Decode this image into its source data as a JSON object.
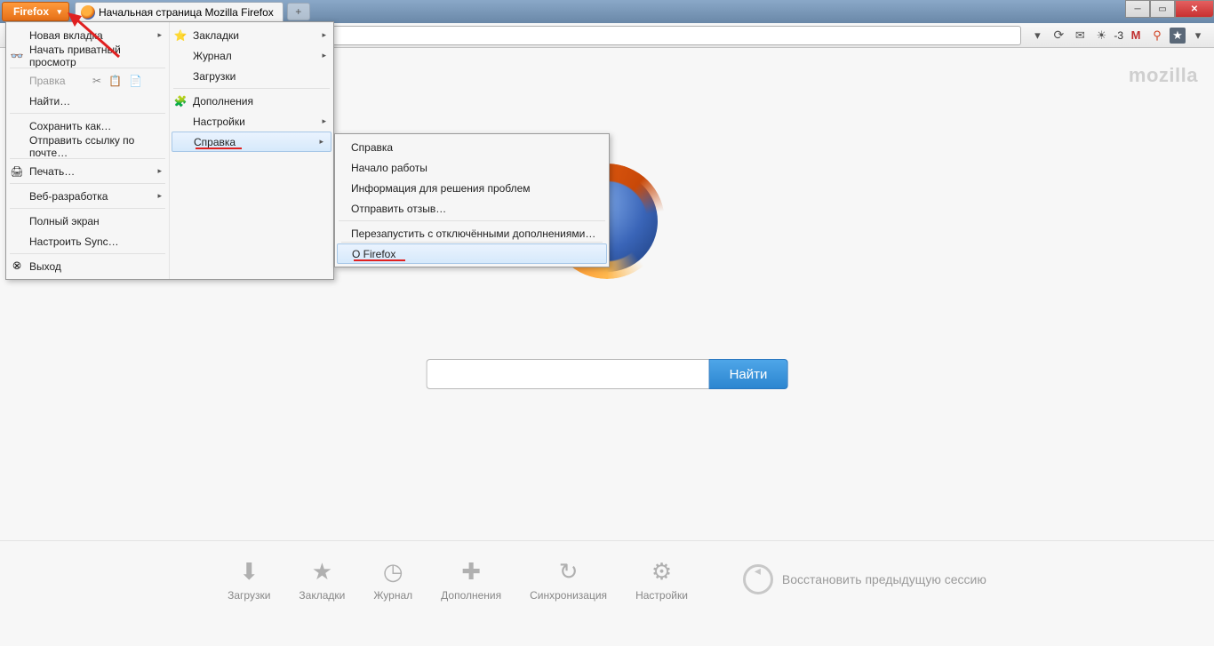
{
  "titlebar": {
    "firefox_button": "Firefox",
    "tab_title": "Начальная страница Mozilla Firefox",
    "new_tab_symbol": "+"
  },
  "toolbar": {
    "temp_text": "-3"
  },
  "main_menu": {
    "left": [
      {
        "label": "Новая вкладка",
        "arrow": true
      },
      {
        "label": "Начать приватный просмотр",
        "icon": "mask"
      },
      {
        "label": "Правка",
        "disabled": true,
        "sep": true,
        "icons_row": true
      },
      {
        "label": "Найти…"
      },
      {
        "label": "Сохранить как…",
        "sep": true
      },
      {
        "label": "Отправить ссылку по почте…"
      },
      {
        "label": "Печать…",
        "icon": "print",
        "arrow": true,
        "sep": true
      },
      {
        "label": "Веб-разработка",
        "arrow": true,
        "sep": true
      },
      {
        "label": "Полный экран",
        "sep": true
      },
      {
        "label": "Настроить Sync…"
      },
      {
        "label": "Выход",
        "icon": "exit",
        "sep": true
      }
    ],
    "right": [
      {
        "label": "Закладки",
        "arrow": true,
        "icon": "star"
      },
      {
        "label": "Журнал",
        "arrow": true
      },
      {
        "label": "Загрузки"
      },
      {
        "label": "Дополнения",
        "icon": "puzzle",
        "sep": true
      },
      {
        "label": "Настройки",
        "arrow": true
      },
      {
        "label": "Справка",
        "arrow": true,
        "highlighted": true,
        "underline": true
      }
    ]
  },
  "help_submenu": [
    {
      "label": "Справка"
    },
    {
      "label": "Начало работы"
    },
    {
      "label": "Информация для решения проблем"
    },
    {
      "label": "Отправить отзыв…"
    },
    {
      "label": "Перезапустить с отключёнными дополнениями…",
      "sep": true
    },
    {
      "label": "О Firefox",
      "sep": true,
      "highlighted": true,
      "underline": true
    }
  ],
  "startpage": {
    "watermark": "mozilla",
    "search_button": "Найти",
    "restore_label": "Восстановить предыдущую сессию",
    "launchers": [
      {
        "label": "Загрузки",
        "icon": "⬇"
      },
      {
        "label": "Закладки",
        "icon": "★"
      },
      {
        "label": "Журнал",
        "icon": "◷"
      },
      {
        "label": "Дополнения",
        "icon": "✚"
      },
      {
        "label": "Синхронизация",
        "icon": "↻"
      },
      {
        "label": "Настройки",
        "icon": "⚙"
      }
    ]
  }
}
